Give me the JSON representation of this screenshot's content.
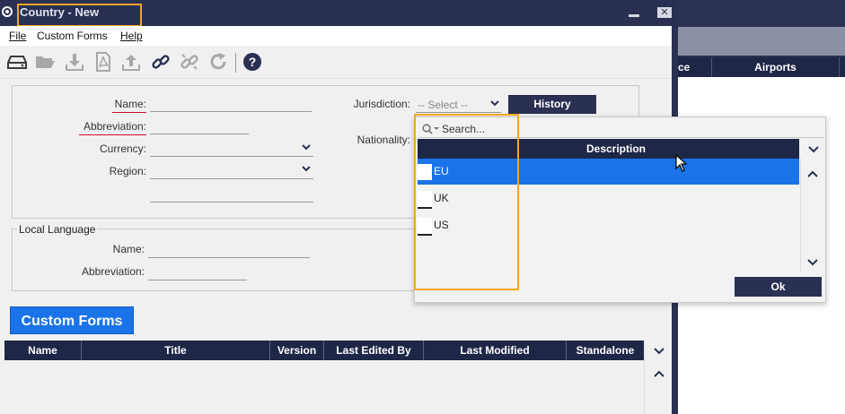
{
  "window": {
    "title": "Country - New",
    "minimize_icon": "minimize-icon",
    "close_label": "✕"
  },
  "menubar": {
    "items": [
      {
        "label": "File"
      },
      {
        "label": "Custom Forms"
      },
      {
        "label": "Help"
      }
    ]
  },
  "toolbar": {
    "icons": [
      "drive-icon",
      "folder-icon",
      "download-icon",
      "pdf-icon",
      "upload-icon",
      "link-icon",
      "unlink-icon",
      "refresh-icon",
      "help-icon"
    ],
    "help_label": "?"
  },
  "form": {
    "name_label": "Name:",
    "abbreviation_label": "Abbreviation:",
    "currency_label": "Currency:",
    "region_label": "Region:",
    "jurisdiction_label": "Jurisdiction:",
    "jurisdiction_placeholder": "-- Select --",
    "nationality_label": "Nationality:",
    "history_button": "History"
  },
  "local_language": {
    "legend": "Local Language",
    "name_label": "Name:",
    "abbreviation_label": "Abbreviation:"
  },
  "custom_forms": {
    "button_label": "Custom Forms",
    "columns": [
      "Name",
      "Title",
      "Version",
      "Last Edited By",
      "Last Modified",
      "Standalone"
    ]
  },
  "dropdown": {
    "search_placeholder": "Search...",
    "column_header": "Description",
    "rows": [
      {
        "label": "EU",
        "selected": true
      },
      {
        "label": "UK",
        "selected": false
      },
      {
        "label": "US",
        "selected": false
      }
    ],
    "ok_label": "Ok"
  },
  "background_app": {
    "columns": [
      "ce",
      "Airports"
    ]
  },
  "colors": {
    "titlebar": "#293052",
    "header": "#1f2747",
    "accent_blue": "#1a73e8",
    "highlight": "#f5a623",
    "required": "#c8102e"
  }
}
